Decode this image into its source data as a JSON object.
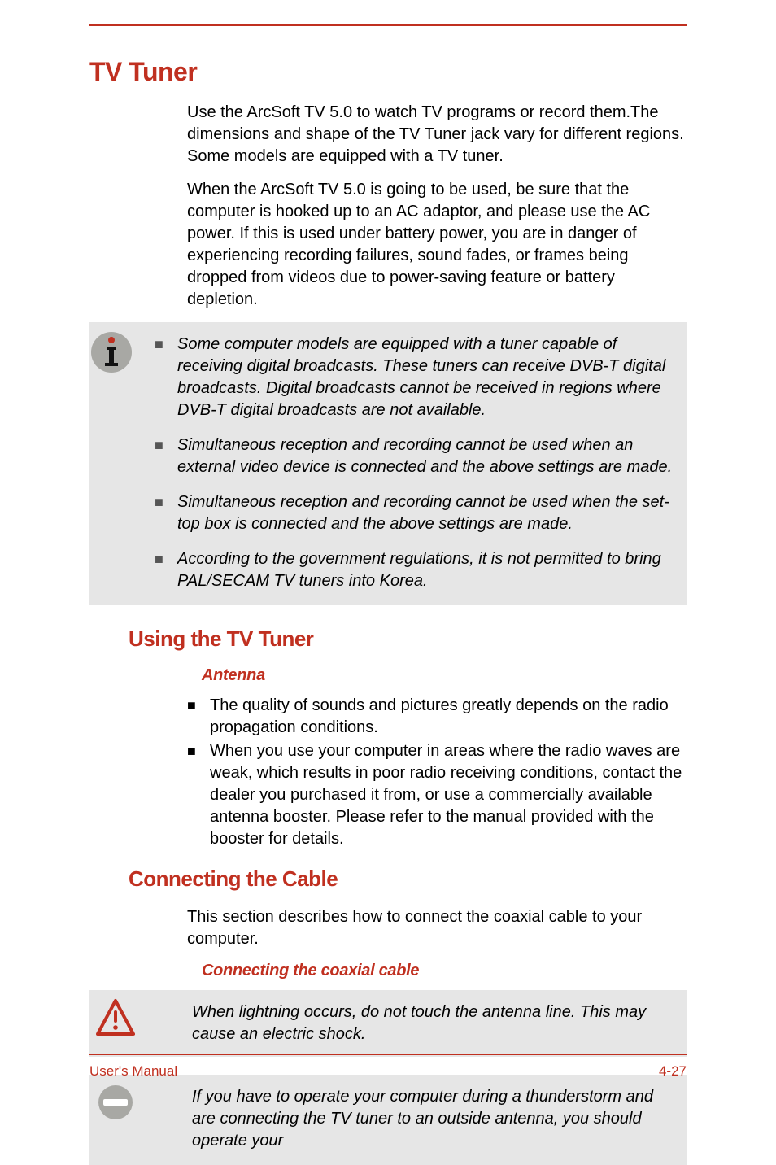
{
  "title": "TV Tuner",
  "intro_p1": "Use the ArcSoft TV 5.0 to watch TV programs or record them.The dimensions and shape of the TV Tuner jack vary for different regions. Some models are equipped with a TV tuner.",
  "intro_p2": "When the ArcSoft TV 5.0 is going to be used, be sure that the computer is hooked up to an AC adaptor, and please use the AC power. If this is used under battery power, you are in danger of experiencing recording failures, sound fades, or frames being dropped from videos due to power-saving feature or battery depletion.",
  "note_items": [
    "Some computer models are equipped with a tuner capable of receiving digital broadcasts. These tuners can receive DVB-T digital broadcasts. Digital broadcasts cannot be received in regions where DVB-T digital broadcasts are not available.",
    "Simultaneous reception and recording cannot be used when an external video device is connected and the above settings are made.",
    "Simultaneous reception and recording cannot be used when the set-top box is connected and the above settings are made.",
    "According to the government regulations, it is not permitted to bring PAL/SECAM TV tuners into Korea."
  ],
  "using_title": "Using the TV Tuner",
  "antenna_title": "Antenna",
  "antenna_items": [
    "The quality of sounds and pictures greatly depends on the radio propagation conditions.",
    "When you use your computer in areas where the radio waves are weak, which results in poor radio receiving conditions, contact the dealer you purchased it from, or use a commercially available antenna booster. Please refer to the manual provided with the booster for details."
  ],
  "connect_title": "Connecting the Cable",
  "connect_intro": "This section describes how to connect the coaxial cable to your computer.",
  "coax_title": "Connecting the coaxial cable",
  "warn1": "When lightning occurs, do not touch the antenna line. This may cause an electric shock.",
  "warn2": "If you have to operate your computer during a thunderstorm and are connecting the TV tuner to an outside antenna, you should operate your",
  "footer_left": "User's Manual",
  "footer_right": "4-27"
}
